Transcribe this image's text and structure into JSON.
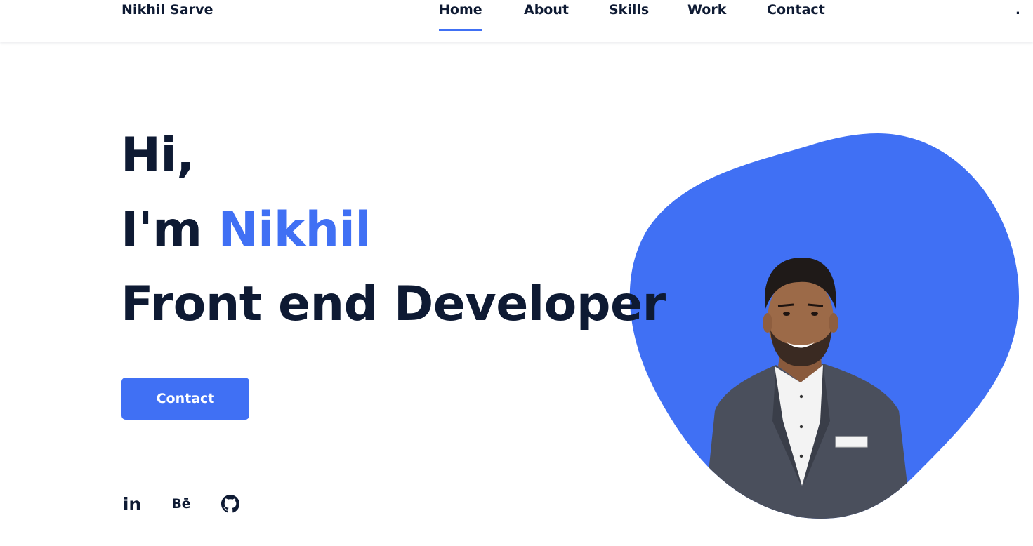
{
  "header": {
    "logo": "Nikhil Sarve",
    "nav": [
      {
        "label": "Home",
        "active": true
      },
      {
        "label": "About",
        "active": false
      },
      {
        "label": "Skills",
        "active": false
      },
      {
        "label": "Work",
        "active": false
      },
      {
        "label": "Contact",
        "active": false
      }
    ],
    "menu_dot": "."
  },
  "hero": {
    "greeting": "Hi,",
    "intro_prefix": "I'm ",
    "name": "Nikhil",
    "role": "Front end Developer",
    "button_label": "Contact",
    "socials": [
      {
        "label": "in",
        "icon": "linkedin-icon"
      },
      {
        "label": "Bē",
        "icon": "behance-icon"
      },
      {
        "label": "",
        "icon": "github-icon"
      }
    ]
  },
  "colors": {
    "accent": "#4070f4",
    "text": "#0e1a33",
    "background": "#ffffff"
  }
}
